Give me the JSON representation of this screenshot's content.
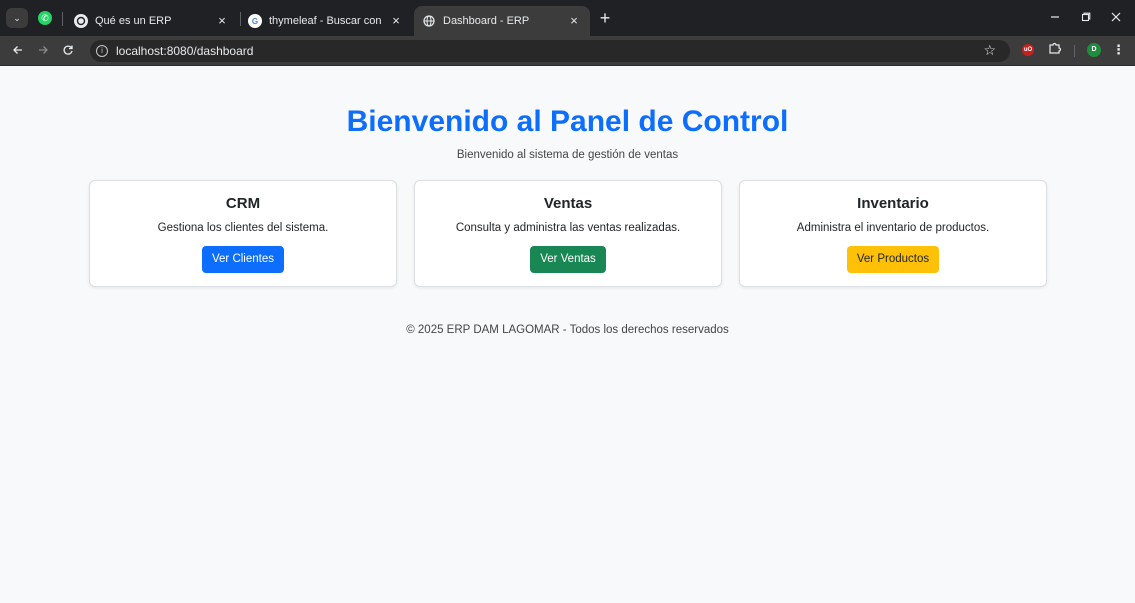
{
  "browser": {
    "tabs": [
      {
        "title": "Qué es un ERP",
        "favicon": "chatgpt-icon"
      },
      {
        "title": "thymeleaf - Buscar con Google",
        "favicon": "google-icon"
      },
      {
        "title": "Dashboard - ERP",
        "favicon": "globe-icon",
        "active": true
      }
    ],
    "tab_close_glyph": "×",
    "new_tab_glyph": "+",
    "url": "localhost:8080/dashboard",
    "profile_initial": "D",
    "ublock_label": "uO",
    "wa_glyph": "✆",
    "google_glyph": "G",
    "tab_search_glyph": "⌄"
  },
  "page": {
    "title": "Bienvenido al Panel de Control",
    "subtitle": "Bienvenido al sistema de gestión de ventas",
    "cards": [
      {
        "title": "CRM",
        "description": "Gestiona los clientes del sistema.",
        "button": "Ver Clientes",
        "button_color": "#0d6efd"
      },
      {
        "title": "Ventas",
        "description": "Consulta y administra las ventas realizadas.",
        "button": "Ver Ventas",
        "button_color": "#198754"
      },
      {
        "title": "Inventario",
        "description": "Administra el inventario de productos.",
        "button": "Ver Productos",
        "button_color": "#ffc107"
      }
    ],
    "footer": "© 2025 ERP DAM LAGOMAR - Todos los derechos reservados"
  },
  "colors": {
    "accent": "#0d6efd",
    "success": "#198754",
    "warning": "#ffc107"
  }
}
